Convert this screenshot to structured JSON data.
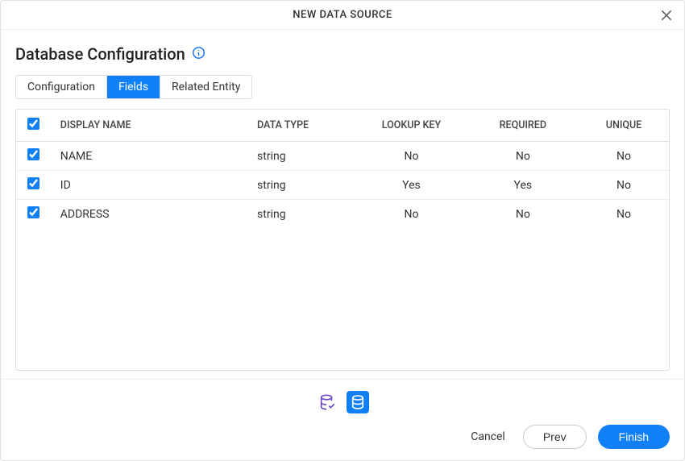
{
  "modal": {
    "title": "NEW DATA SOURCE"
  },
  "section": {
    "title": "Database Configuration"
  },
  "tabs": {
    "configuration": "Configuration",
    "fields": "Fields",
    "related_entity": "Related Entity"
  },
  "table": {
    "headers": {
      "display_name": "DISPLAY NAME",
      "data_type": "DATA TYPE",
      "lookup_key": "LOOKUP KEY",
      "required": "REQUIRED",
      "unique": "UNIQUE"
    },
    "rows": [
      {
        "name": "NAME",
        "type": "string",
        "lookup": "No",
        "required": "No",
        "unique": "No"
      },
      {
        "name": "ID",
        "type": "string",
        "lookup": "Yes",
        "required": "Yes",
        "unique": "No"
      },
      {
        "name": "ADDRESS",
        "type": "string",
        "lookup": "No",
        "required": "No",
        "unique": "No"
      }
    ]
  },
  "footer": {
    "cancel": "Cancel",
    "prev": "Prev",
    "finish": "Finish"
  }
}
